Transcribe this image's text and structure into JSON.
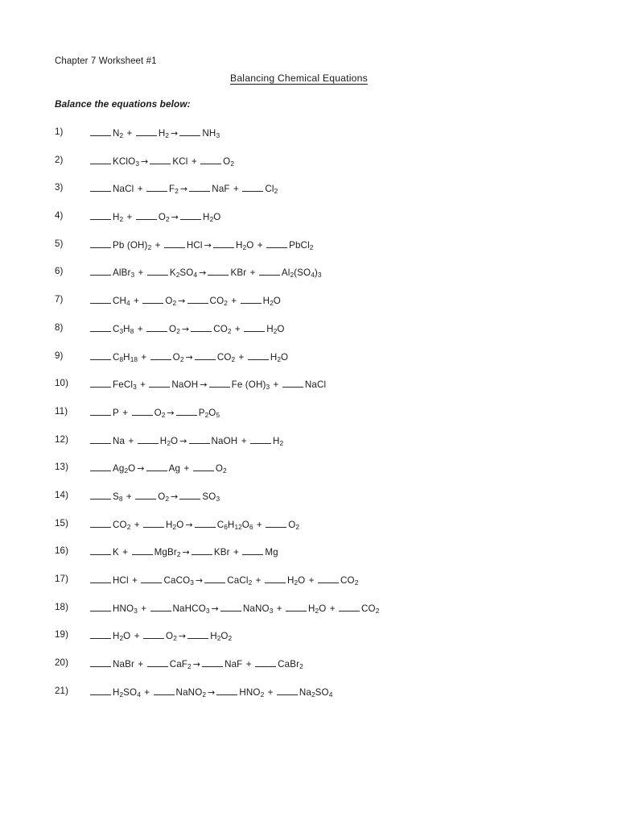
{
  "document": {
    "worksheet_label": "Chapter 7 Worksheet #1",
    "title": "Balancing Chemical Equations",
    "instruction": "Balance the equations below:"
  },
  "symbols": {
    "arrow": "→",
    "plus": "+",
    "blank": "____"
  },
  "equations": [
    {
      "number": "1)",
      "reactants": [
        {
          "formula": "N2",
          "parts": [
            {
              "t": "N"
            },
            {
              "t": "2",
              "sub": true
            }
          ]
        },
        {
          "formula": "H2",
          "parts": [
            {
              "t": "H"
            },
            {
              "t": "2",
              "sub": true
            }
          ]
        }
      ],
      "products": [
        {
          "formula": "NH3",
          "parts": [
            {
              "t": "NH"
            },
            {
              "t": "3",
              "sub": true
            }
          ]
        }
      ]
    },
    {
      "number": "2)",
      "reactants": [
        {
          "formula": "KClO3",
          "parts": [
            {
              "t": "KClO"
            },
            {
              "t": "3",
              "sub": true
            }
          ]
        }
      ],
      "products": [
        {
          "formula": "KCl",
          "parts": [
            {
              "t": "KCl"
            }
          ]
        },
        {
          "formula": "O2",
          "parts": [
            {
              "t": "O"
            },
            {
              "t": "2",
              "sub": true
            }
          ]
        }
      ]
    },
    {
      "number": "3)",
      "reactants": [
        {
          "formula": "NaCl",
          "parts": [
            {
              "t": "NaCl"
            }
          ]
        },
        {
          "formula": "F2",
          "parts": [
            {
              "t": "F"
            },
            {
              "t": "2",
              "sub": true
            }
          ]
        }
      ],
      "products": [
        {
          "formula": "NaF",
          "parts": [
            {
              "t": "NaF"
            }
          ]
        },
        {
          "formula": "Cl2",
          "parts": [
            {
              "t": "Cl"
            },
            {
              "t": "2",
              "sub": true
            }
          ]
        }
      ]
    },
    {
      "number": "4)",
      "reactants": [
        {
          "formula": "H2",
          "parts": [
            {
              "t": "H"
            },
            {
              "t": "2",
              "sub": true
            }
          ]
        },
        {
          "formula": "O2",
          "parts": [
            {
              "t": "O"
            },
            {
              "t": "2",
              "sub": true
            }
          ]
        }
      ],
      "products": [
        {
          "formula": "H2O",
          "parts": [
            {
              "t": "H"
            },
            {
              "t": "2",
              "sub": true
            },
            {
              "t": "O"
            }
          ]
        }
      ]
    },
    {
      "number": "5)",
      "reactants": [
        {
          "formula": "Pb(OH)2",
          "parts": [
            {
              "t": "Pb (OH)"
            },
            {
              "t": "2",
              "sub": true
            }
          ]
        },
        {
          "formula": "HCl",
          "parts": [
            {
              "t": "HCl"
            }
          ]
        }
      ],
      "products": [
        {
          "formula": "H2O",
          "parts": [
            {
              "t": "H"
            },
            {
              "t": "2",
              "sub": true
            },
            {
              "t": "O"
            }
          ]
        },
        {
          "formula": "PbCl2",
          "parts": [
            {
              "t": "PbCl"
            },
            {
              "t": "2",
              "sub": true
            }
          ]
        }
      ]
    },
    {
      "number": "6)",
      "reactants": [
        {
          "formula": "AlBr3",
          "parts": [
            {
              "t": "AlBr"
            },
            {
              "t": "3",
              "sub": true
            }
          ]
        },
        {
          "formula": "K2SO4",
          "parts": [
            {
              "t": "K"
            },
            {
              "t": "2",
              "sub": true
            },
            {
              "t": "SO"
            },
            {
              "t": "4",
              "sub": true
            }
          ]
        }
      ],
      "products": [
        {
          "formula": "KBr",
          "parts": [
            {
              "t": "KBr"
            }
          ]
        },
        {
          "formula": "Al2(SO4)3",
          "parts": [
            {
              "t": "Al"
            },
            {
              "t": "2",
              "sub": true
            },
            {
              "t": "(SO"
            },
            {
              "t": "4",
              "sub": true
            },
            {
              "t": ")"
            },
            {
              "t": "3",
              "sub": true
            }
          ]
        }
      ]
    },
    {
      "number": "7)",
      "reactants": [
        {
          "formula": "CH4",
          "parts": [
            {
              "t": "CH"
            },
            {
              "t": "4",
              "sub": true
            }
          ]
        },
        {
          "formula": "O2",
          "parts": [
            {
              "t": "O"
            },
            {
              "t": "2",
              "sub": true
            }
          ]
        }
      ],
      "products": [
        {
          "formula": "CO2",
          "parts": [
            {
              "t": "CO"
            },
            {
              "t": "2",
              "sub": true
            }
          ]
        },
        {
          "formula": "H2O",
          "parts": [
            {
              "t": "H"
            },
            {
              "t": "2",
              "sub": true
            },
            {
              "t": "O"
            }
          ]
        }
      ]
    },
    {
      "number": "8)",
      "reactants": [
        {
          "formula": "C3H8",
          "parts": [
            {
              "t": "C"
            },
            {
              "t": "3",
              "sub": true
            },
            {
              "t": "H"
            },
            {
              "t": "8",
              "sub": true
            }
          ]
        },
        {
          "formula": "O2",
          "parts": [
            {
              "t": "O"
            },
            {
              "t": "2",
              "sub": true
            }
          ]
        }
      ],
      "products": [
        {
          "formula": "CO2",
          "parts": [
            {
              "t": "CO"
            },
            {
              "t": "2",
              "sub": true
            }
          ]
        },
        {
          "formula": "H2O",
          "parts": [
            {
              "t": "H"
            },
            {
              "t": "2",
              "sub": true
            },
            {
              "t": "O"
            }
          ]
        }
      ]
    },
    {
      "number": "9)",
      "reactants": [
        {
          "formula": "C8H18",
          "parts": [
            {
              "t": "C"
            },
            {
              "t": "8",
              "sub": true
            },
            {
              "t": "H"
            },
            {
              "t": "18",
              "sub": true
            }
          ]
        },
        {
          "formula": "O2",
          "parts": [
            {
              "t": "O"
            },
            {
              "t": "2",
              "sub": true
            }
          ]
        }
      ],
      "products": [
        {
          "formula": "CO2",
          "parts": [
            {
              "t": "CO"
            },
            {
              "t": "2",
              "sub": true
            }
          ]
        },
        {
          "formula": "H2O",
          "parts": [
            {
              "t": "H"
            },
            {
              "t": "2",
              "sub": true
            },
            {
              "t": "O"
            }
          ]
        }
      ]
    },
    {
      "number": "10)",
      "reactants": [
        {
          "formula": "FeCl3",
          "parts": [
            {
              "t": "FeCl"
            },
            {
              "t": "3",
              "sub": true
            }
          ]
        },
        {
          "formula": "NaOH",
          "parts": [
            {
              "t": "NaOH"
            }
          ]
        }
      ],
      "products": [
        {
          "formula": "Fe(OH)3",
          "parts": [
            {
              "t": "Fe (OH)"
            },
            {
              "t": "3",
              "sub": true
            }
          ]
        },
        {
          "formula": "NaCl",
          "parts": [
            {
              "t": "NaCl"
            }
          ]
        }
      ]
    },
    {
      "number": "11)",
      "reactants": [
        {
          "formula": "P",
          "parts": [
            {
              "t": "P"
            }
          ]
        },
        {
          "formula": "O2",
          "parts": [
            {
              "t": "O"
            },
            {
              "t": "2",
              "sub": true
            }
          ]
        }
      ],
      "products": [
        {
          "formula": "P2O5",
          "parts": [
            {
              "t": "P"
            },
            {
              "t": "2",
              "sub": true
            },
            {
              "t": "O"
            },
            {
              "t": "5",
              "sub": true
            }
          ]
        }
      ]
    },
    {
      "number": "12)",
      "reactants": [
        {
          "formula": "Na",
          "parts": [
            {
              "t": "Na"
            }
          ]
        },
        {
          "formula": "H2O",
          "parts": [
            {
              "t": "H"
            },
            {
              "t": "2",
              "sub": true
            },
            {
              "t": "O"
            }
          ]
        }
      ],
      "products": [
        {
          "formula": "NaOH",
          "parts": [
            {
              "t": "NaOH"
            }
          ]
        },
        {
          "formula": "H2",
          "parts": [
            {
              "t": "H"
            },
            {
              "t": "2",
              "sub": true
            }
          ]
        }
      ]
    },
    {
      "number": "13)",
      "reactants": [
        {
          "formula": "Ag2O",
          "parts": [
            {
              "t": "Ag"
            },
            {
              "t": "2",
              "sub": true
            },
            {
              "t": "O"
            }
          ]
        }
      ],
      "products": [
        {
          "formula": "Ag",
          "parts": [
            {
              "t": "Ag"
            }
          ]
        },
        {
          "formula": "O2",
          "parts": [
            {
              "t": "O"
            },
            {
              "t": "2",
              "sub": true
            }
          ]
        }
      ]
    },
    {
      "number": "14)",
      "reactants": [
        {
          "formula": "S8",
          "parts": [
            {
              "t": "S"
            },
            {
              "t": "8",
              "sub": true
            }
          ]
        },
        {
          "formula": "O2",
          "parts": [
            {
              "t": "O"
            },
            {
              "t": "2",
              "sub": true
            }
          ]
        }
      ],
      "products": [
        {
          "formula": "SO3",
          "parts": [
            {
              "t": "SO"
            },
            {
              "t": "3",
              "sub": true
            }
          ]
        }
      ]
    },
    {
      "number": "15)",
      "reactants": [
        {
          "formula": "CO2",
          "parts": [
            {
              "t": "CO"
            },
            {
              "t": "2",
              "sub": true
            }
          ]
        },
        {
          "formula": "H2O",
          "parts": [
            {
              "t": "H"
            },
            {
              "t": "2",
              "sub": true
            },
            {
              "t": "O"
            }
          ]
        }
      ],
      "products": [
        {
          "formula": "C6H12O6",
          "parts": [
            {
              "t": "C"
            },
            {
              "t": "6",
              "sub": true
            },
            {
              "t": "H"
            },
            {
              "t": "12",
              "sub": true
            },
            {
              "t": "O"
            },
            {
              "t": "6",
              "sub": true
            }
          ]
        },
        {
          "formula": "O2",
          "parts": [
            {
              "t": "O"
            },
            {
              "t": "2",
              "sub": true
            }
          ]
        }
      ]
    },
    {
      "number": "16)",
      "reactants": [
        {
          "formula": "K",
          "parts": [
            {
              "t": "K"
            }
          ]
        },
        {
          "formula": "MgBr2",
          "parts": [
            {
              "t": "MgBr"
            },
            {
              "t": "2",
              "sub": true
            }
          ]
        }
      ],
      "products": [
        {
          "formula": "KBr",
          "parts": [
            {
              "t": "KBr"
            }
          ]
        },
        {
          "formula": "Mg",
          "parts": [
            {
              "t": "Mg"
            }
          ]
        }
      ]
    },
    {
      "number": "17)",
      "reactants": [
        {
          "formula": "HCl",
          "parts": [
            {
              "t": "HCl"
            }
          ]
        },
        {
          "formula": "CaCO3",
          "parts": [
            {
              "t": "CaCO"
            },
            {
              "t": "3",
              "sub": true
            }
          ]
        }
      ],
      "products": [
        {
          "formula": "CaCl2",
          "parts": [
            {
              "t": "CaCl"
            },
            {
              "t": "2",
              "sub": true
            }
          ]
        },
        {
          "formula": "H2O",
          "parts": [
            {
              "t": "H"
            },
            {
              "t": "2",
              "sub": true
            },
            {
              "t": "O"
            }
          ]
        },
        {
          "formula": "CO2",
          "parts": [
            {
              "t": "CO"
            },
            {
              "t": "2",
              "sub": true
            }
          ]
        }
      ]
    },
    {
      "number": "18)",
      "reactants": [
        {
          "formula": "HNO3",
          "parts": [
            {
              "t": "HNO"
            },
            {
              "t": "3",
              "sub": true
            }
          ]
        },
        {
          "formula": "NaHCO3",
          "parts": [
            {
              "t": "NaHCO"
            },
            {
              "t": "3",
              "sub": true
            }
          ]
        }
      ],
      "products": [
        {
          "formula": "NaNO3",
          "parts": [
            {
              "t": "NaNO"
            },
            {
              "t": "3",
              "sub": true
            }
          ]
        },
        {
          "formula": "H2O",
          "parts": [
            {
              "t": "H"
            },
            {
              "t": "2",
              "sub": true
            },
            {
              "t": "O"
            }
          ]
        },
        {
          "formula": "CO2",
          "parts": [
            {
              "t": "CO"
            },
            {
              "t": "2",
              "sub": true
            }
          ]
        }
      ]
    },
    {
      "number": "19)",
      "reactants": [
        {
          "formula": "H2O",
          "parts": [
            {
              "t": "H"
            },
            {
              "t": "2",
              "sub": true
            },
            {
              "t": "O"
            }
          ]
        },
        {
          "formula": "O2",
          "parts": [
            {
              "t": "O"
            },
            {
              "t": "2",
              "sub": true
            }
          ]
        }
      ],
      "products": [
        {
          "formula": "H2O2",
          "parts": [
            {
              "t": "H"
            },
            {
              "t": "2",
              "sub": true
            },
            {
              "t": "O"
            },
            {
              "t": "2",
              "sub": true
            }
          ]
        }
      ]
    },
    {
      "number": "20)",
      "reactants": [
        {
          "formula": "NaBr",
          "parts": [
            {
              "t": "NaBr"
            }
          ]
        },
        {
          "formula": "CaF2",
          "parts": [
            {
              "t": "CaF"
            },
            {
              "t": "2",
              "sub": true
            }
          ]
        }
      ],
      "products": [
        {
          "formula": "NaF",
          "parts": [
            {
              "t": "NaF"
            }
          ]
        },
        {
          "formula": "CaBr2",
          "parts": [
            {
              "t": "CaBr"
            },
            {
              "t": "2",
              "sub": true
            }
          ]
        }
      ]
    },
    {
      "number": "21)",
      "reactants": [
        {
          "formula": "H2SO4",
          "parts": [
            {
              "t": "H"
            },
            {
              "t": "2",
              "sub": true
            },
            {
              "t": "SO"
            },
            {
              "t": "4",
              "sub": true
            }
          ]
        },
        {
          "formula": "NaNO2",
          "parts": [
            {
              "t": "NaNO"
            },
            {
              "t": "2",
              "sub": true
            }
          ]
        }
      ],
      "products": [
        {
          "formula": "HNO2",
          "parts": [
            {
              "t": "HNO"
            },
            {
              "t": "2",
              "sub": true
            }
          ]
        },
        {
          "formula": "Na2SO4",
          "parts": [
            {
              "t": "Na"
            },
            {
              "t": "2",
              "sub": true
            },
            {
              "t": "SO"
            },
            {
              "t": "4",
              "sub": true
            }
          ]
        }
      ]
    }
  ]
}
